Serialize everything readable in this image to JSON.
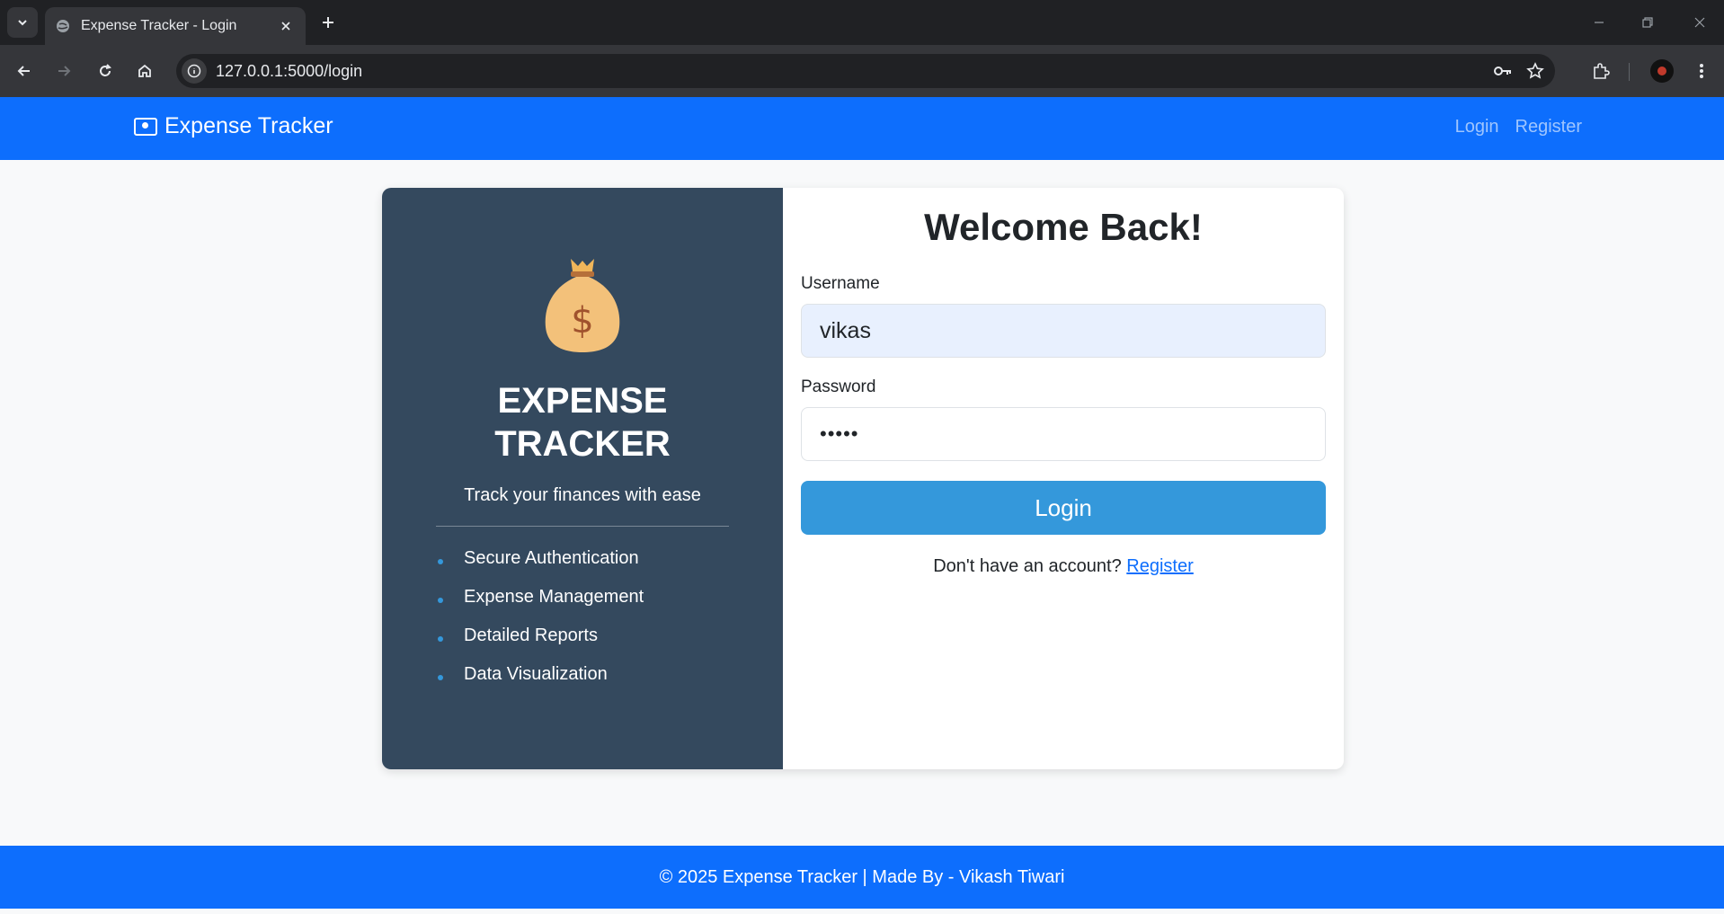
{
  "browser": {
    "tab_title": "Expense Tracker - Login",
    "url": "127.0.0.1:5000/login"
  },
  "navbar": {
    "brand": "Expense Tracker",
    "links": [
      "Login",
      "Register"
    ]
  },
  "hero": {
    "title_line1": "EXPENSE",
    "title_line2": "TRACKER",
    "tagline": "Track your finances with ease",
    "features": [
      "Secure Authentication",
      "Expense Management",
      "Detailed Reports",
      "Data Visualization"
    ]
  },
  "login_form": {
    "heading": "Welcome Back!",
    "username_label": "Username",
    "username_value": "vikas",
    "password_label": "Password",
    "password_value": "•••••",
    "submit_label": "Login",
    "signup_prompt": "Don't have an account?",
    "signup_link": "Register"
  },
  "footer": {
    "text": "© 2025 Expense Tracker | Made By - Vikash Tiwari"
  },
  "colors": {
    "primary": "#0d6efd",
    "panel": "#34495e",
    "button": "#3498db"
  }
}
